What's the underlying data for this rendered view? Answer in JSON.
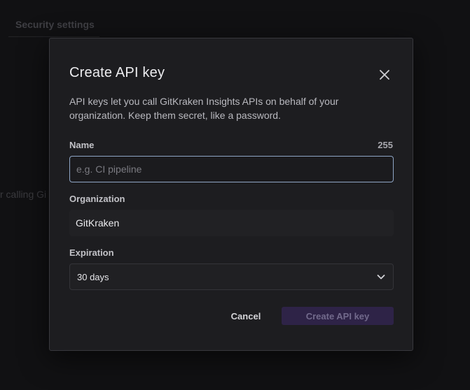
{
  "background": {
    "tab_label": "Security settings",
    "partial_text": "r calling Gi"
  },
  "modal": {
    "title": "Create API key",
    "description": "API keys let you call GitKraken Insights APIs on behalf of your organization. Keep them secret, like a password.",
    "name": {
      "label": "Name",
      "char_count": "255",
      "placeholder": "e.g. CI pipeline",
      "value": ""
    },
    "organization": {
      "label": "Organization",
      "value": "GitKraken"
    },
    "expiration": {
      "label": "Expiration",
      "selected": "30 days"
    },
    "buttons": {
      "cancel": "Cancel",
      "create": "Create API key"
    },
    "icons": {
      "close": "close-icon",
      "dropdown": "chevron-down-icon"
    },
    "colors": {
      "create_button_bg": "#2e2347",
      "input_focus_border": "#8fa6c6"
    }
  }
}
